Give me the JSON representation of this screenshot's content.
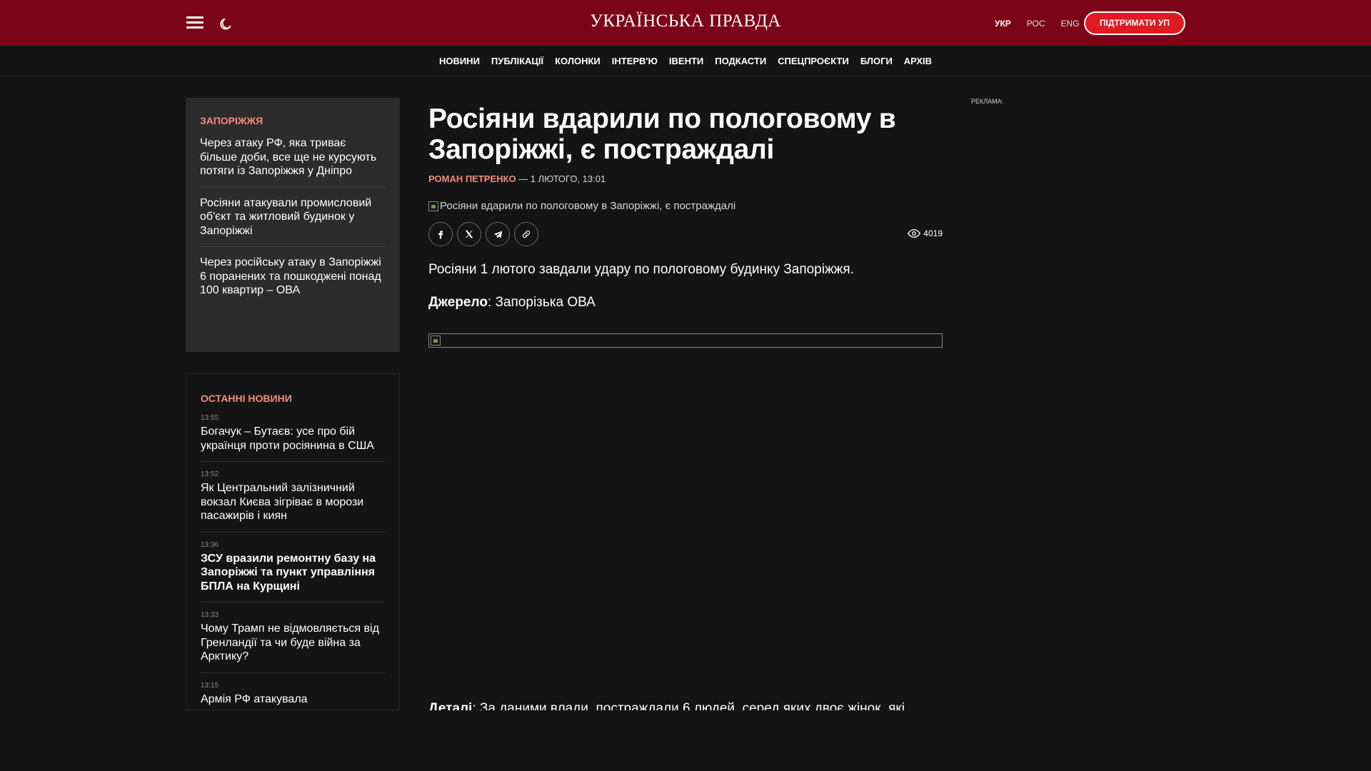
{
  "header": {
    "logo_text": "УКРАЇНСЬКА ПРАВДА",
    "languages": [
      "УКР",
      "РОС",
      "ENG"
    ],
    "active_language": "УКР",
    "support_button": "ПІДТРИМАТИ УП",
    "colors": {
      "brand": "#7c0418",
      "support": "#e01a21",
      "accent": "#f28d7d"
    }
  },
  "nav": {
    "items": [
      "НОВИНИ",
      "ПУБЛІКАЦІЇ",
      "КОЛОНКИ",
      "ІНТЕРВ'Ю",
      "ІВЕНТИ",
      "ПОДКАСТИ",
      "СПЕЦПРОЄКТИ",
      "БЛОГИ",
      "АРХІВ"
    ]
  },
  "region": {
    "title": "ЗАПОРІЖЖЯ",
    "items": [
      "Через атаку РФ, яка триває більше доби, все ще не курсують потяги із Запоріжжя у Дніпро",
      "Росіяни атакували промисловий об'єкт та житловий будинок у Запоріжжі",
      "Через російську атаку в Запоріжжі 6 поранених та пошкоджені понад 100 квартир – ОВА"
    ]
  },
  "latest": {
    "title": "ОСТАННІ НОВИНИ",
    "items": [
      {
        "time": "13:55",
        "title": "Богачук – Бутаєв: усе про бій українця проти росіянина в США",
        "bold": false
      },
      {
        "time": "13:52",
        "title": "Як Центральний залізничний вокзал Києва зігріває в морози пасажирів і киян",
        "bold": false
      },
      {
        "time": "13:36",
        "title": "ЗСУ вразили ремонтну базу на Запоріжжі та пункт управління БПЛА на Курщині",
        "bold": true
      },
      {
        "time": "13:33",
        "title": "Чому Трамп не відмовляється від Гренландії та чи буде війна за Арктику?",
        "bold": false
      },
      {
        "time": "13:15",
        "title": "Армія РФ атакувала",
        "bold": false
      }
    ]
  },
  "article": {
    "headline": "Росіяни вдарили по пологовому в Запоріжжі, є постраждалі",
    "author": "РОМАН ПЕТРЕНКО",
    "date": " — 1 ЛЮТОГО, 13:01",
    "image_alt": "Росіяни вдарили по пологовому в Запоріжжі, є постраждалі",
    "views": "4019",
    "share_icons": [
      "facebook-icon",
      "x-icon",
      "telegram-icon",
      "link-icon"
    ],
    "lead": "Росіяни 1 лютого завдали удару по пологовому будинку Запоріжжя.",
    "source_label": "Джерело",
    "source_text": ": Запорізька ОВА",
    "details_label": "Деталі",
    "details_text": ": За даними влади, постраждали 6 людей, серед яких двоє жінок, які"
  },
  "ad": {
    "label": "РЕКЛАМА:"
  }
}
